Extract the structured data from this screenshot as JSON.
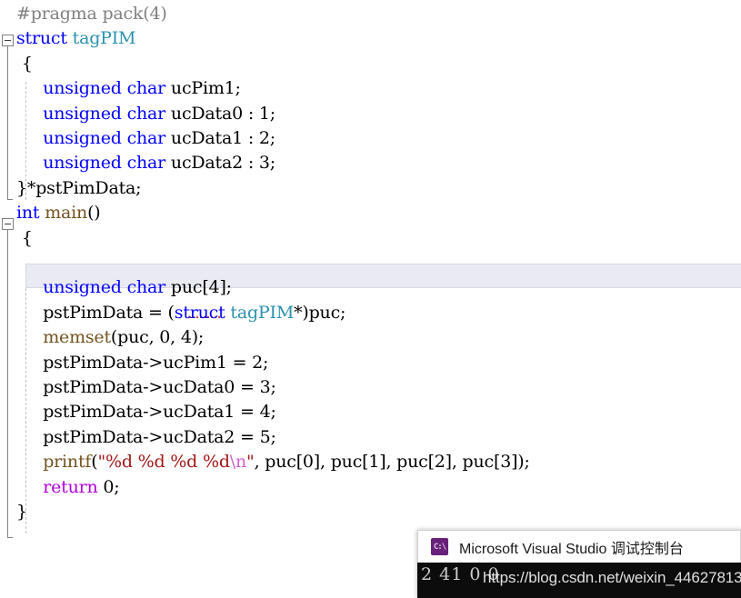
{
  "editor": {
    "lines": [
      {
        "indent": 0,
        "segments": [
          {
            "t": "#pragma pack(4)",
            "c": "pp"
          }
        ]
      },
      {
        "indent": 0,
        "segments": [
          {
            "t": "struct",
            "c": "kw"
          },
          {
            "t": " ",
            "c": "plain"
          },
          {
            "t": "tagPIM",
            "c": "type"
          }
        ]
      },
      {
        "indent": 0,
        "segments": [
          {
            "t": " {",
            "c": "plain"
          }
        ]
      },
      {
        "indent": 0,
        "segments": [
          {
            "t": "     ",
            "c": "plain"
          },
          {
            "t": "unsigned",
            "c": "kw"
          },
          {
            "t": " ",
            "c": "plain"
          },
          {
            "t": "char",
            "c": "kw"
          },
          {
            "t": " ucPim1;",
            "c": "plain"
          }
        ]
      },
      {
        "indent": 0,
        "segments": [
          {
            "t": "     ",
            "c": "plain"
          },
          {
            "t": "unsigned",
            "c": "kw"
          },
          {
            "t": " ",
            "c": "plain"
          },
          {
            "t": "char",
            "c": "kw"
          },
          {
            "t": " ucData0 : 1;",
            "c": "plain"
          }
        ]
      },
      {
        "indent": 0,
        "segments": [
          {
            "t": "     ",
            "c": "plain"
          },
          {
            "t": "unsigned",
            "c": "kw"
          },
          {
            "t": " ",
            "c": "plain"
          },
          {
            "t": "char",
            "c": "kw"
          },
          {
            "t": " ucData1 : 2;",
            "c": "plain"
          }
        ]
      },
      {
        "indent": 0,
        "segments": [
          {
            "t": "     ",
            "c": "plain"
          },
          {
            "t": "unsigned",
            "c": "kw"
          },
          {
            "t": " ",
            "c": "plain"
          },
          {
            "t": "char",
            "c": "kw"
          },
          {
            "t": " ucData2 : 3;",
            "c": "plain"
          }
        ]
      },
      {
        "indent": 0,
        "segments": [
          {
            "t": "}*pstPimData;",
            "c": "plain"
          }
        ]
      },
      {
        "indent": 0,
        "segments": [
          {
            "t": "int",
            "c": "kw"
          },
          {
            "t": " ",
            "c": "plain"
          },
          {
            "t": "main",
            "c": "fn"
          },
          {
            "t": "()",
            "c": "plain"
          }
        ]
      },
      {
        "indent": 0,
        "segments": [
          {
            "t": " {",
            "c": "plain"
          }
        ]
      },
      {
        "indent": 0,
        "segments": [
          {
            "t": "",
            "c": "plain"
          }
        ]
      },
      {
        "indent": 0,
        "segments": [
          {
            "t": "     ",
            "c": "plain"
          },
          {
            "t": "unsigned",
            "c": "kw"
          },
          {
            "t": " ",
            "c": "plain"
          },
          {
            "t": "char",
            "c": "kw"
          },
          {
            "t": " puc[4];",
            "c": "plain"
          }
        ]
      },
      {
        "indent": 0,
        "segments": [
          {
            "t": "     pstPimData = (",
            "c": "plain"
          },
          {
            "t": "struct",
            "c": "kw"
          },
          {
            "t": " ",
            "c": "plain"
          },
          {
            "t": "tagPIM",
            "c": "type"
          },
          {
            "t": "*)puc;",
            "c": "plain"
          }
        ]
      },
      {
        "indent": 0,
        "segments": [
          {
            "t": "     ",
            "c": "plain"
          },
          {
            "t": "memset",
            "c": "fn"
          },
          {
            "t": "(puc, 0, 4);",
            "c": "plain"
          }
        ]
      },
      {
        "indent": 0,
        "segments": [
          {
            "t": "     pstPimData->ucPim1 = 2;",
            "c": "plain"
          }
        ]
      },
      {
        "indent": 0,
        "segments": [
          {
            "t": "     pstPimData->ucData0 = 3;",
            "c": "plain"
          }
        ]
      },
      {
        "indent": 0,
        "segments": [
          {
            "t": "     pstPimData->ucData1 = 4;",
            "c": "plain"
          }
        ]
      },
      {
        "indent": 0,
        "segments": [
          {
            "t": "     pstPimData->ucData2 = 5;",
            "c": "plain"
          }
        ]
      },
      {
        "indent": 0,
        "segments": [
          {
            "t": "     ",
            "c": "plain"
          },
          {
            "t": "printf",
            "c": "fn"
          },
          {
            "t": "(",
            "c": "plain"
          },
          {
            "t": "\"%d %d %d %d",
            "c": "str"
          },
          {
            "t": "\\n",
            "c": "esc"
          },
          {
            "t": "\"",
            "c": "str"
          },
          {
            "t": ", puc[0], puc[1], puc[2], puc[3]);",
            "c": "plain"
          }
        ]
      },
      {
        "indent": 0,
        "segments": [
          {
            "t": "     ",
            "c": "plain"
          },
          {
            "t": "return",
            "c": "ctl"
          },
          {
            "t": " 0;",
            "c": "plain"
          }
        ]
      },
      {
        "indent": 0,
        "segments": [
          {
            "t": "}",
            "c": "plain"
          }
        ]
      }
    ],
    "current_line_index": 10
  },
  "console": {
    "title": "Microsoft Visual Studio 调试控制台",
    "icon": "console-app-icon",
    "icon_glyph": "C:\\",
    "output": "2 41 0 0"
  },
  "watermark": {
    "text": "https://blog.csdn.net/weixin_44627813"
  },
  "colors": {
    "keyword": "#0000FF",
    "type": "#2B91AF",
    "function": "#74531F",
    "preprocessor": "#808080",
    "string": "#A31515",
    "escape": "#D160D1",
    "control_keyword": "#AF00DB",
    "editor_background": "#FFFFFF",
    "current_line_background": "#EAEAF2",
    "console_background": "#0C0C0C",
    "console_icon": "#68217A"
  }
}
